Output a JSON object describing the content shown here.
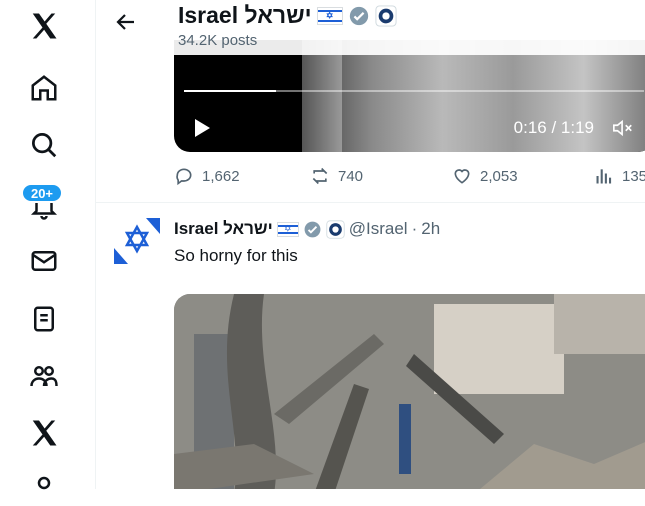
{
  "nav": {
    "badge": "20+",
    "items": [
      "x-logo-icon",
      "home-icon",
      "search-icon",
      "notifications-icon",
      "messages-icon",
      "lists-icon",
      "communities-icon",
      "premium-x-icon",
      "more-icon"
    ]
  },
  "header": {
    "title": "Israel ישראל",
    "subtitle": "34.2K posts"
  },
  "video": {
    "time": "0:16 / 1:19",
    "progress": 0.2
  },
  "post1": {
    "replies": "1,662",
    "reposts": "740",
    "likes": "2,053",
    "views": "135"
  },
  "post2": {
    "name": "Israel ישראל",
    "handle": "@Israel",
    "dot": "·",
    "time": "2h",
    "text": "So horny for this"
  },
  "colors": {
    "accent": "#1d9bf0",
    "verified": "#829aab",
    "muted": "#536471"
  }
}
